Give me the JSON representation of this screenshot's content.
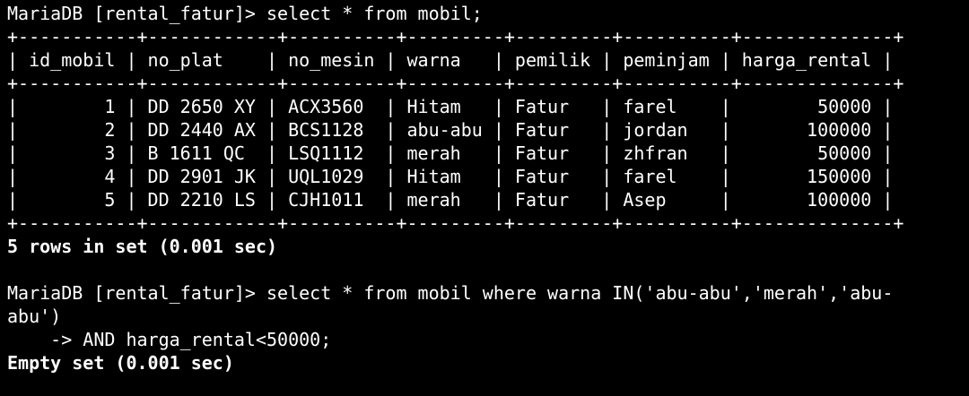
{
  "terminal": {
    "prompt1": "MariaDB [rental_fatur]> select * from mobil;",
    "border_top": "+-----------+------------+----------+---------+---------+----------+--------------+",
    "header": "| id_mobil | no_plat    | no_mesin | warna   | pemilik | peminjam | harga_rental |",
    "border_mid": "+-----------+------------+----------+---------+---------+----------+--------------+",
    "rows": [
      "|        1 | DD 2650 XY | ACX3560  | Hitam   | Fatur   | farel    |        50000 |",
      "|        2 | DD 2440 AX | BCS1128  | abu-abu | Fatur   | jordan   |       100000 |",
      "|        3 | B 1611 QC  | LSQ1112  | merah   | Fatur   | zhfran   |        50000 |",
      "|        4 | DD 2901 JK | UQL1029  | Hitam   | Fatur   | farel    |       150000 |",
      "|        5 | DD 2210 LS | CJH1011  | merah   | Fatur   | Asep     |       100000 |"
    ],
    "border_bottom": "+-----------+------------+----------+---------+---------+----------+--------------+",
    "result1": "5 rows in set (0.001 sec)",
    "blank": "",
    "prompt2_line1": "MariaDB [rental_fatur]> select * from mobil where warna IN('abu-abu','merah','abu-",
    "prompt2_line2": "abu')",
    "prompt2_line3": "    -> AND harga_rental<50000;",
    "result2": "Empty set (0.001 sec)"
  }
}
